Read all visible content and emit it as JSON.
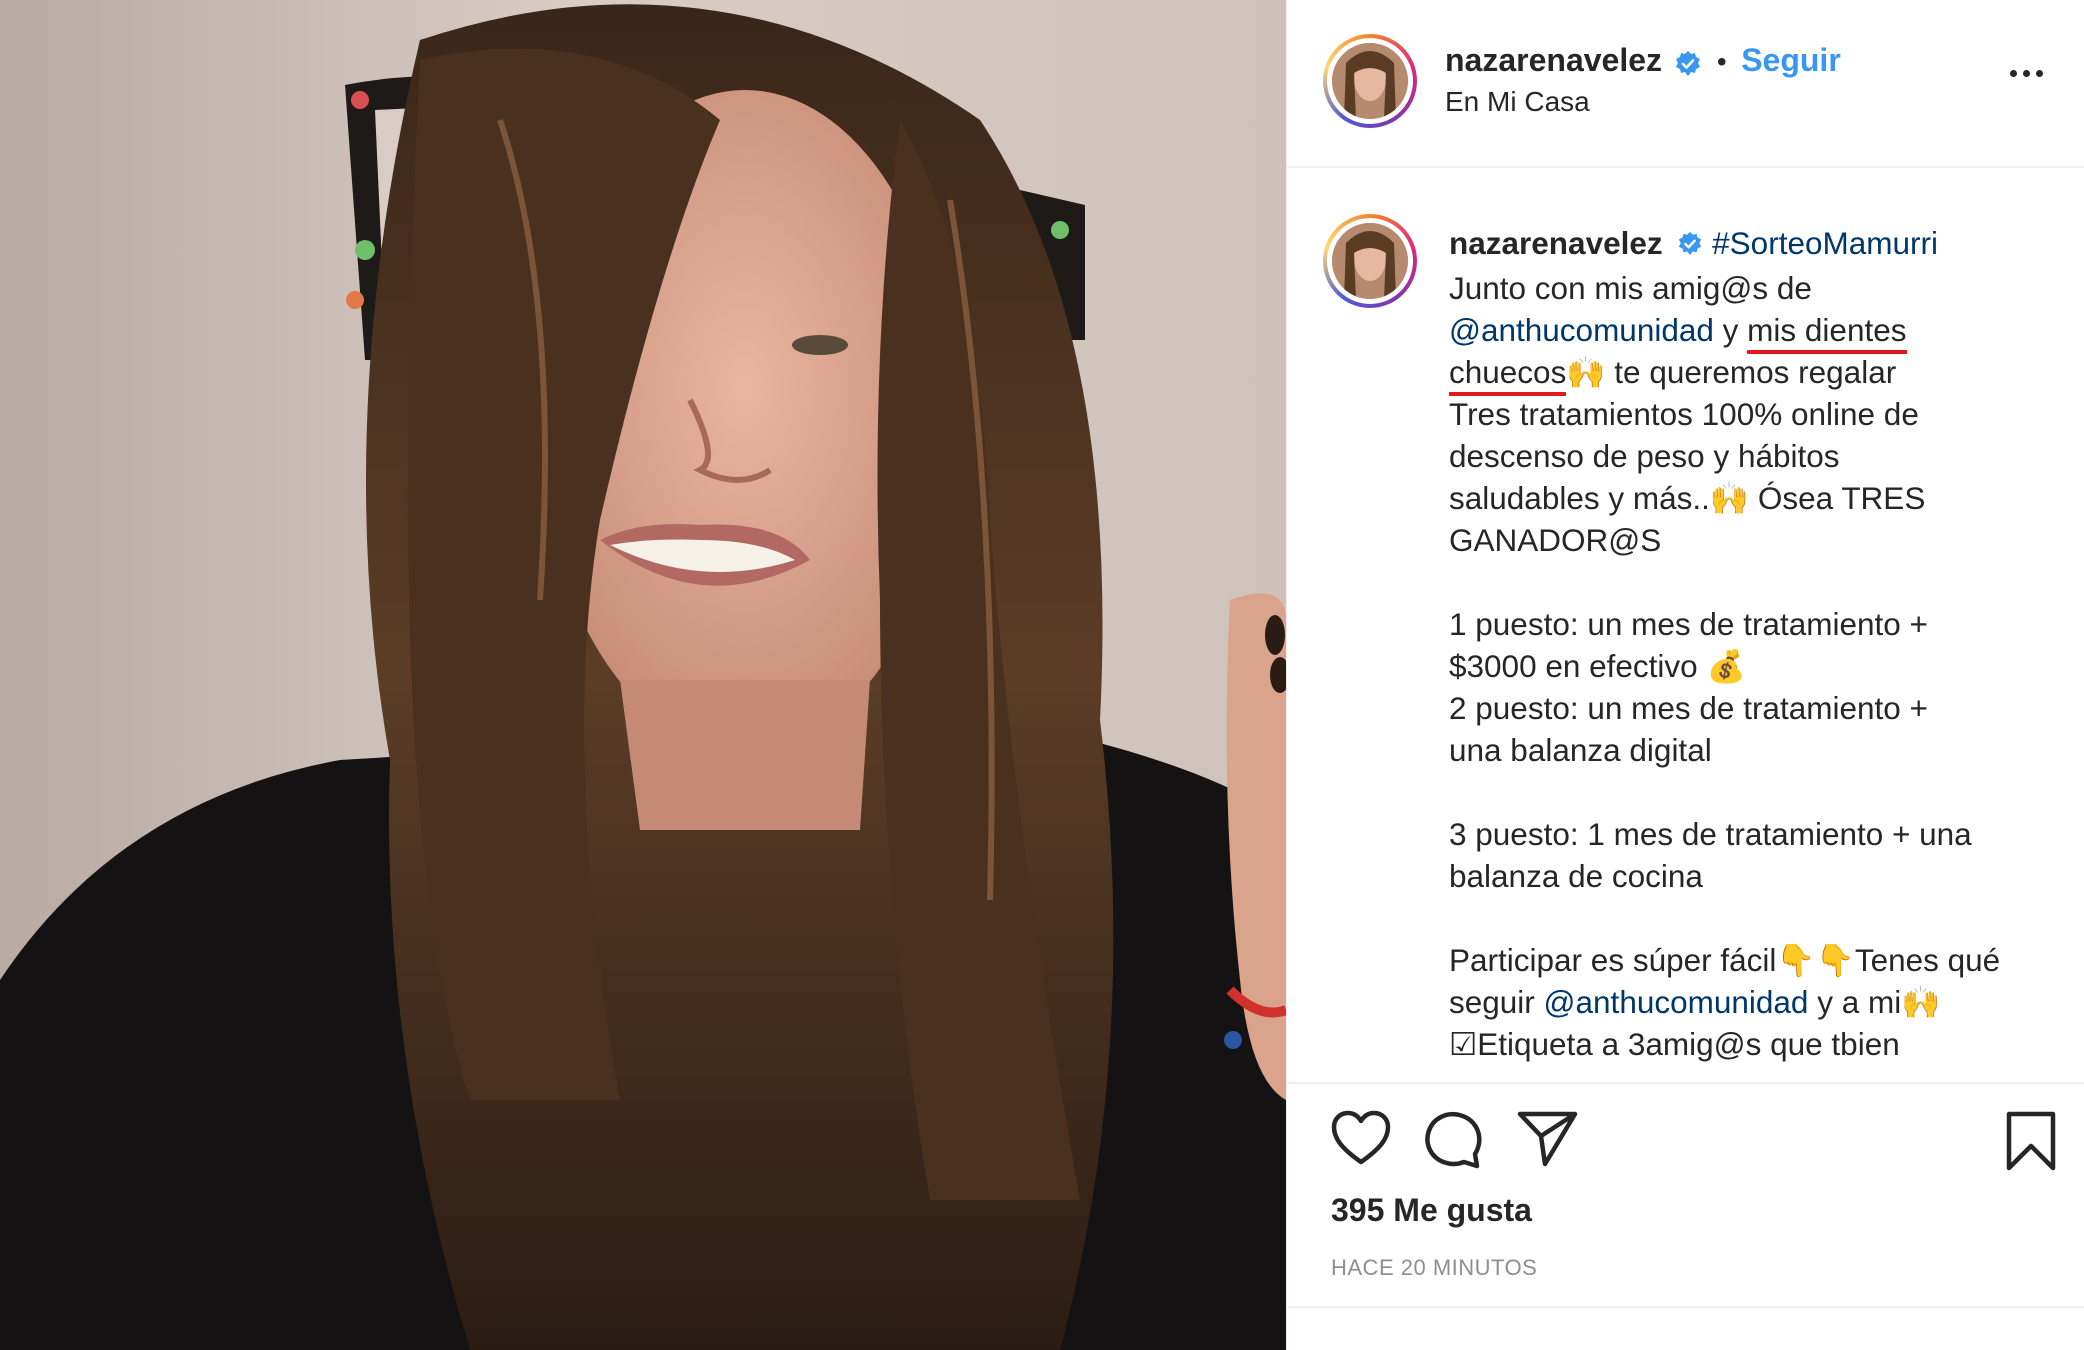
{
  "post": {
    "username": "nazarenavelez",
    "follow_label": "Seguir",
    "separator": "•",
    "location": "En Mi Casa",
    "caption": {
      "hashtag": "#SorteoMamurri",
      "l1": "Junto con mis amig@s de",
      "mention1": "@anthucomunidad",
      "l2_mid": " y ",
      "l2_ul": "mis dientes",
      "l3_ul": "chuecos",
      "l3_rest": "🙌 te queremos regalar",
      "l4": "Tres tratamientos 100% online de",
      "l5": "descenso de peso y hábitos",
      "l6": "saludables y más..🙌 Ósea TRES",
      "l7": "GANADOR@S",
      "l8": "1 puesto: un mes de tratamiento +",
      "l9": "$3000 en efectivo 💰",
      "l10": "2 puesto: un mes de tratamiento +",
      "l11": "una balanza digital",
      "l12": "3 puesto: 1 mes de tratamiento + una",
      "l13": "balanza de cocina",
      "l14": "Participar es súper fácil👇👇Tenes qué",
      "l15_pre": "seguir ",
      "mention2": "@anthucomunidad",
      "l15_post": " y a mi🙌",
      "l16": "☑Etiqueta a 3amig@s que tbien"
    },
    "likes": "395 Me gusta",
    "time": "HACE 20 MINUTOS"
  },
  "icons": [
    "more-options-icon",
    "verified-badge-icon",
    "heart-icon",
    "comment-icon",
    "share-icon",
    "bookmark-icon"
  ],
  "colors": {
    "link": "#3897f0",
    "mention": "#00376b",
    "underline": "#e0191b",
    "muted": "#8e8e8e"
  }
}
